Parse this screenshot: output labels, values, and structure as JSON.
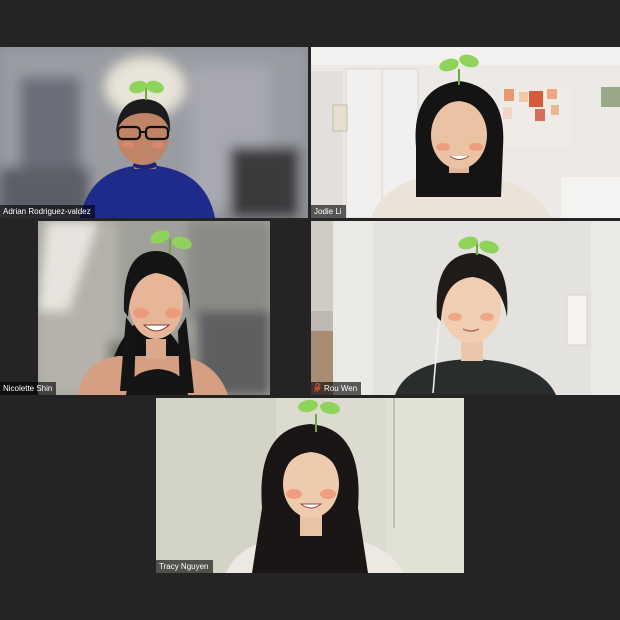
{
  "meeting": {
    "participants": [
      {
        "name": "Adrian Rodriguez-valdez",
        "muted": false,
        "active_speaker": false
      },
      {
        "name": "Jodie Li",
        "muted": false,
        "active_speaker": true
      },
      {
        "name": "Nicolette Shin",
        "muted": false,
        "active_speaker": false
      },
      {
        "name": "Rou Wen",
        "muted": true,
        "active_speaker": false
      },
      {
        "name": "Tracy Nguyen",
        "muted": false,
        "active_speaker": false
      }
    ],
    "filter": "sprout-headband",
    "colors": {
      "background": "#242424",
      "active_speaker_border": "#9bd341",
      "sprout_leaf": "#8fd35b",
      "muted_icon": "#e0453a"
    },
    "icons": [
      "microphone-muted-icon",
      "sprout-headband-icon"
    ]
  }
}
